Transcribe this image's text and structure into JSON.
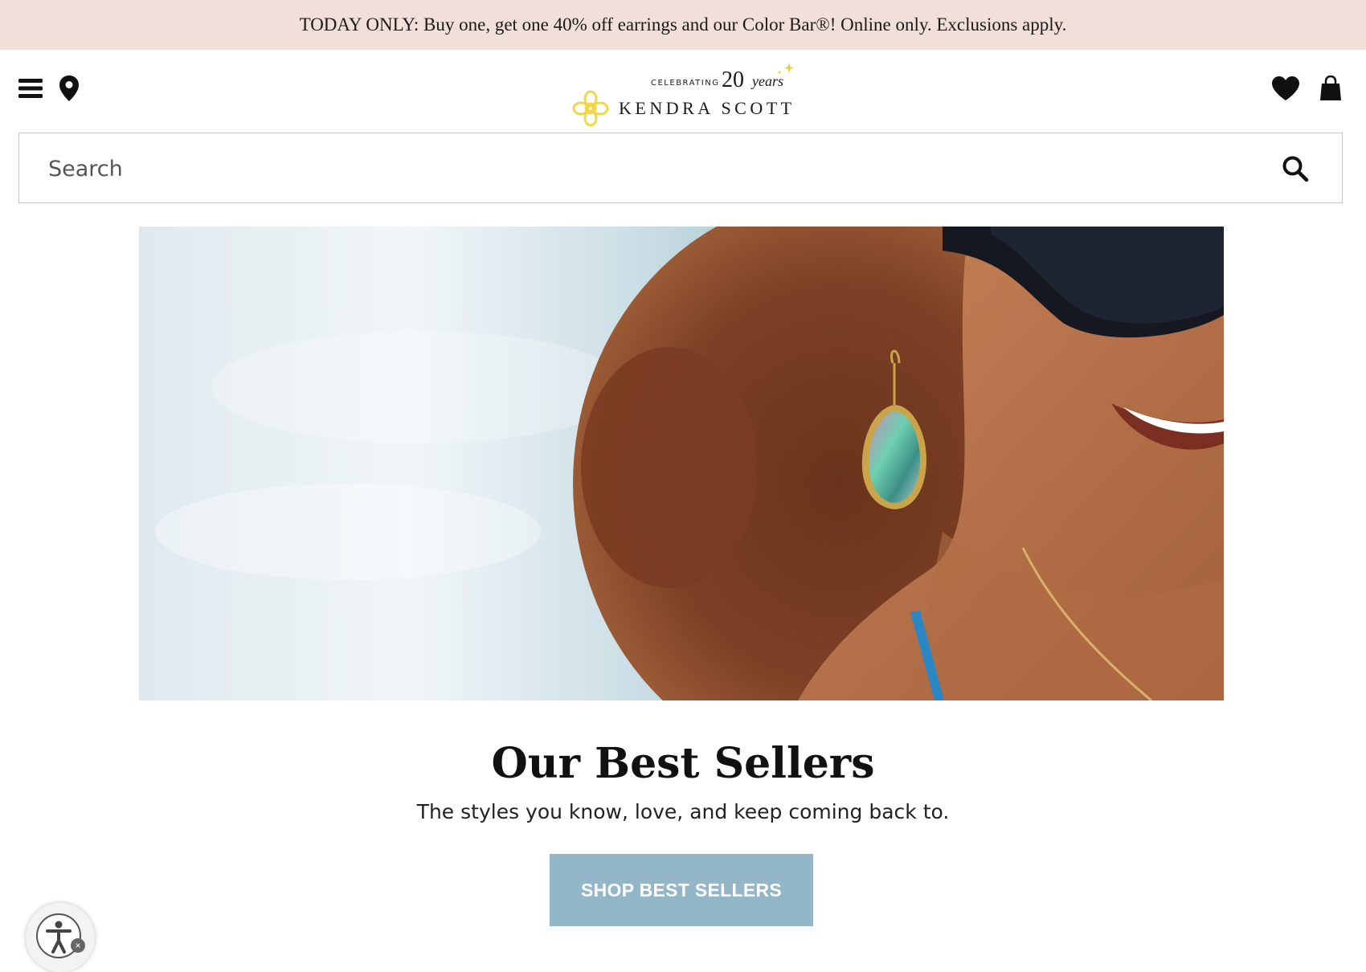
{
  "promo": {
    "text": "TODAY ONLY: Buy one, get one 40% off earrings and our Color Bar®! Online only. Exclusions apply."
  },
  "header": {
    "icons": {
      "menu": "menu-icon",
      "location": "location-pin-icon",
      "wishlist": "heart-icon",
      "bag": "shopping-bag-icon"
    },
    "logo": {
      "celebrating": "CELEBRATING",
      "years_number": "20",
      "years_word": "years",
      "brand": "KENDRA SCOTT"
    }
  },
  "search": {
    "placeholder": "Search",
    "value": ""
  },
  "main": {
    "title": "Our Best Sellers",
    "subtitle": "The styles you know, love, and keep coming back to.",
    "cta_label": "SHOP BEST SELLERS"
  },
  "colors": {
    "promo_bg": "#f2dfd9",
    "cta_bg": "#93b6c8",
    "logo_gold": "#f0d64a"
  }
}
